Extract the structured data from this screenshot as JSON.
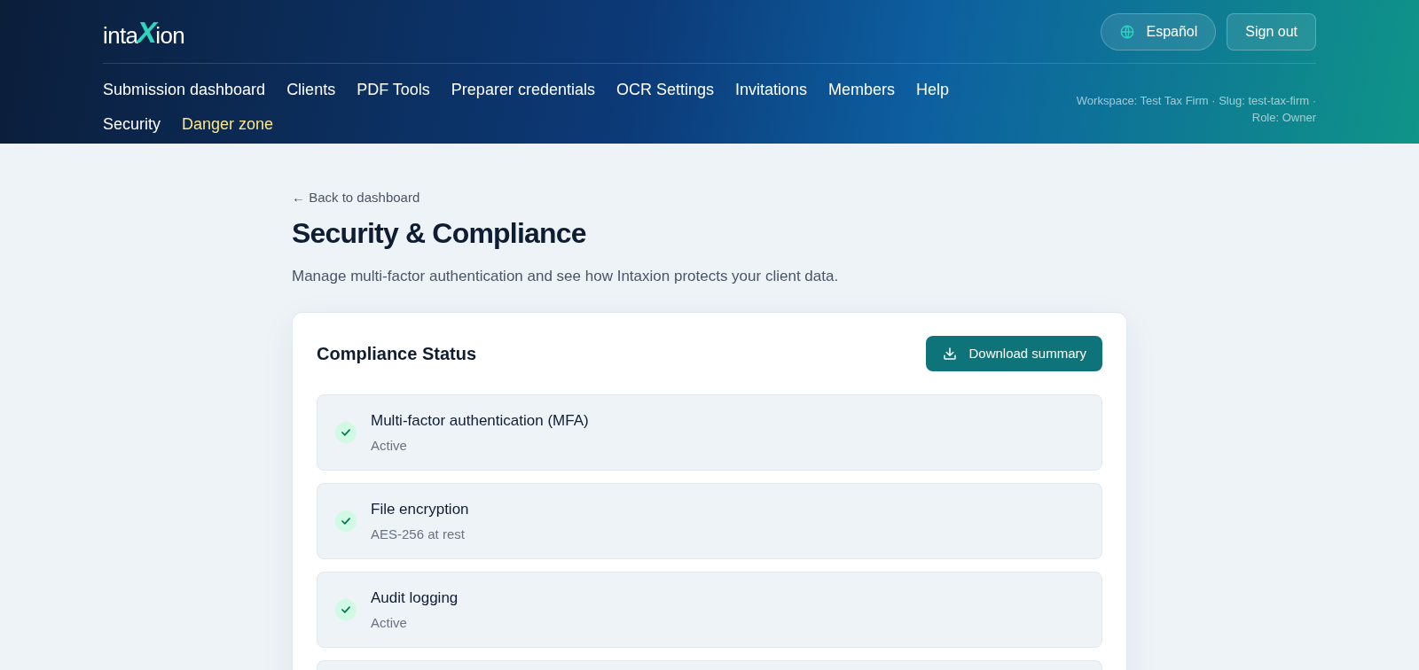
{
  "header": {
    "logo": [
      {
        "kind": "plain",
        "text": "inta"
      },
      {
        "kind": "mark",
        "text": "X"
      },
      {
        "kind": "plain",
        "text": "ion"
      }
    ],
    "language_button": "Español",
    "sign_out_button": "Sign out",
    "nav": [
      {
        "label": "Submission dashboard",
        "kind": "normal"
      },
      {
        "label": "Clients",
        "kind": "normal"
      },
      {
        "label": "PDF Tools",
        "kind": "normal"
      },
      {
        "label": "Preparer credentials",
        "kind": "normal"
      },
      {
        "label": "OCR Settings",
        "kind": "normal"
      },
      {
        "label": "Invitations",
        "kind": "normal"
      },
      {
        "label": "Members",
        "kind": "normal"
      },
      {
        "label": "Help",
        "kind": "normal"
      },
      {
        "label": "Security",
        "kind": "normal"
      },
      {
        "label": "Danger zone",
        "kind": "danger"
      }
    ],
    "workspace_info": "Workspace: Test Tax Firm · Slug: test-tax-firm · Role: Owner"
  },
  "page": {
    "back_link": "← Back to dashboard",
    "title": "Security & Compliance",
    "subtitle": "Manage multi-factor authentication and see how Intaxion protects your client data."
  },
  "compliance": {
    "title": "Compliance Status",
    "download_button": "Download summary",
    "items": [
      {
        "name": "Multi-factor authentication (MFA)",
        "detail": "Active",
        "checked": true
      },
      {
        "name": "File encryption",
        "detail": "AES-256 at rest",
        "checked": true
      },
      {
        "name": "Audit logging",
        "detail": "Active",
        "checked": true
      }
    ]
  }
}
